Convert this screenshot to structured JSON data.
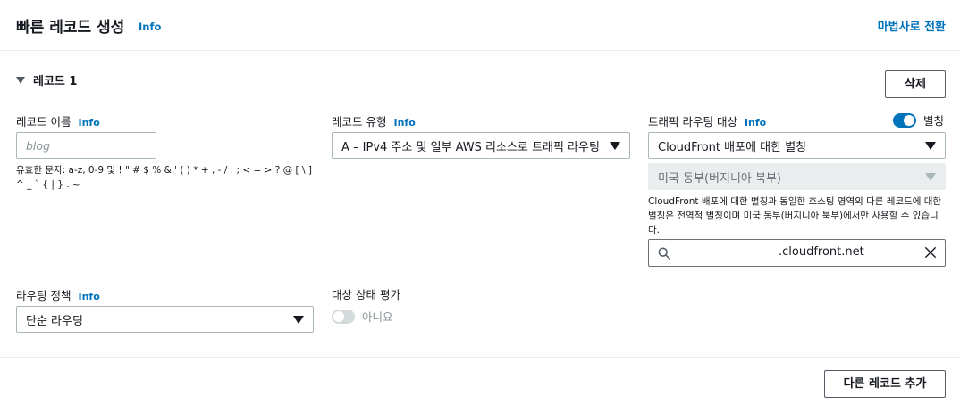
{
  "header": {
    "title": "빠른 레코드 생성",
    "info": "Info",
    "switch_wizard": "마법사로 전환"
  },
  "record": {
    "section_title": "레코드 1",
    "delete_label": "삭제",
    "name": {
      "label": "레코드 이름",
      "info": "Info",
      "placeholder": "blog",
      "hint": "유효한 문자: a-z, 0-9 및 ! \" # $ % & ' ( ) * + , - / : ; < = > ? @ [ \\ ] ^ _ ` { | } . ~"
    },
    "type": {
      "label": "레코드 유형",
      "info": "Info",
      "value": "A – IPv4 주소 및 일부 AWS 리소스로 트래픽 라우팅"
    },
    "target": {
      "label": "트래픽 라우팅 대상",
      "info": "Info",
      "alias_label": "별칭",
      "alias_on": true,
      "endpoint_value": "CloudFront 배포에 대한 별칭",
      "region_value": "미국 동부(버지니아 북부)",
      "hint": "CloudFront 배포에 대한 별칭과 동일한 호스팅 영역의 다른 레코드에 대한 별칭은 전역적 별칭이며 미국 동부(버지니아 북부)에서만 사용할 수 있습니다.",
      "search_value": ".cloudfront.net",
      "search_icon": "search-icon",
      "clear_icon": "close-icon"
    },
    "routing": {
      "label": "라우팅 정책",
      "info": "Info",
      "value": "단순 라우팅"
    },
    "health": {
      "label": "대상 상태 평가",
      "toggle_label": "아니요",
      "on": false
    }
  },
  "footer": {
    "add_label": "다른 레코드 추가"
  },
  "colors": {
    "accent": "#0073bb",
    "text": "#16191f",
    "border": "#aab7b8"
  }
}
